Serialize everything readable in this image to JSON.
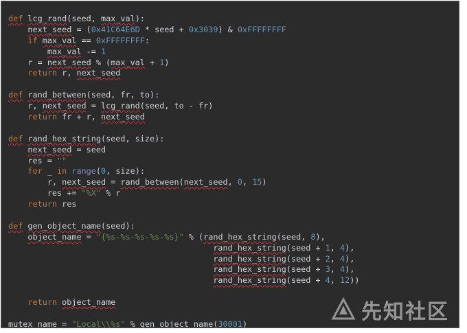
{
  "editor": {
    "code_lines": [
      "def lcg_rand(seed, max_val):",
      "    next_seed = (0x41C64E6D * seed + 0x3039) & 0xFFFFFFFF",
      "    if max_val == 0xFFFFFFFF:",
      "        max_val -= 1",
      "    r = next_seed % (max_val + 1)",
      "    return r, next_seed",
      "",
      "def rand_between(seed, fr, to):",
      "    r, next_seed = lcg_rand(seed, to - fr)",
      "    return fr + r, next_seed",
      "",
      "def rand_hex_string(seed, size):",
      "    next_seed = seed",
      "    res = \"\"",
      "    for _ in range(0, size):",
      "        r, next_seed = rand_between(next_seed, 0, 15)",
      "        res += \"%X\" % r",
      "    return res",
      "",
      "def gen_object_name(seed):",
      "    object_name = \"{%s-%s-%s-%s-%s}\" % (rand_hex_string(seed, 8),",
      "                                          rand_hex_string(seed + 1, 4),",
      "                                          rand_hex_string(seed + 2, 4),",
      "                                          rand_hex_string(seed + 3, 4),",
      "                                          rand_hex_string(seed + 4, 12))",
      "",
      "    return object_name",
      "",
      "mutex_name = \"Local\\\\%s\" % gen_object_name(30001)"
    ],
    "underlined_identifiers": [
      "lcg_rand",
      "next_seed",
      "max_val",
      "rand_between",
      "rand_hex_string",
      "gen_object_name",
      "object_name",
      "mutex_name"
    ],
    "colors": {
      "background": "#2b2b2b",
      "text": "#cfd2d6",
      "keyword": "#cc7832",
      "number": "#6897bb",
      "string": "#6a8759",
      "builtin": "#8888c6",
      "squiggle": "#c8323c"
    }
  },
  "watermark": {
    "text": "先知社区",
    "icon": "xianzhi-logo-icon"
  }
}
